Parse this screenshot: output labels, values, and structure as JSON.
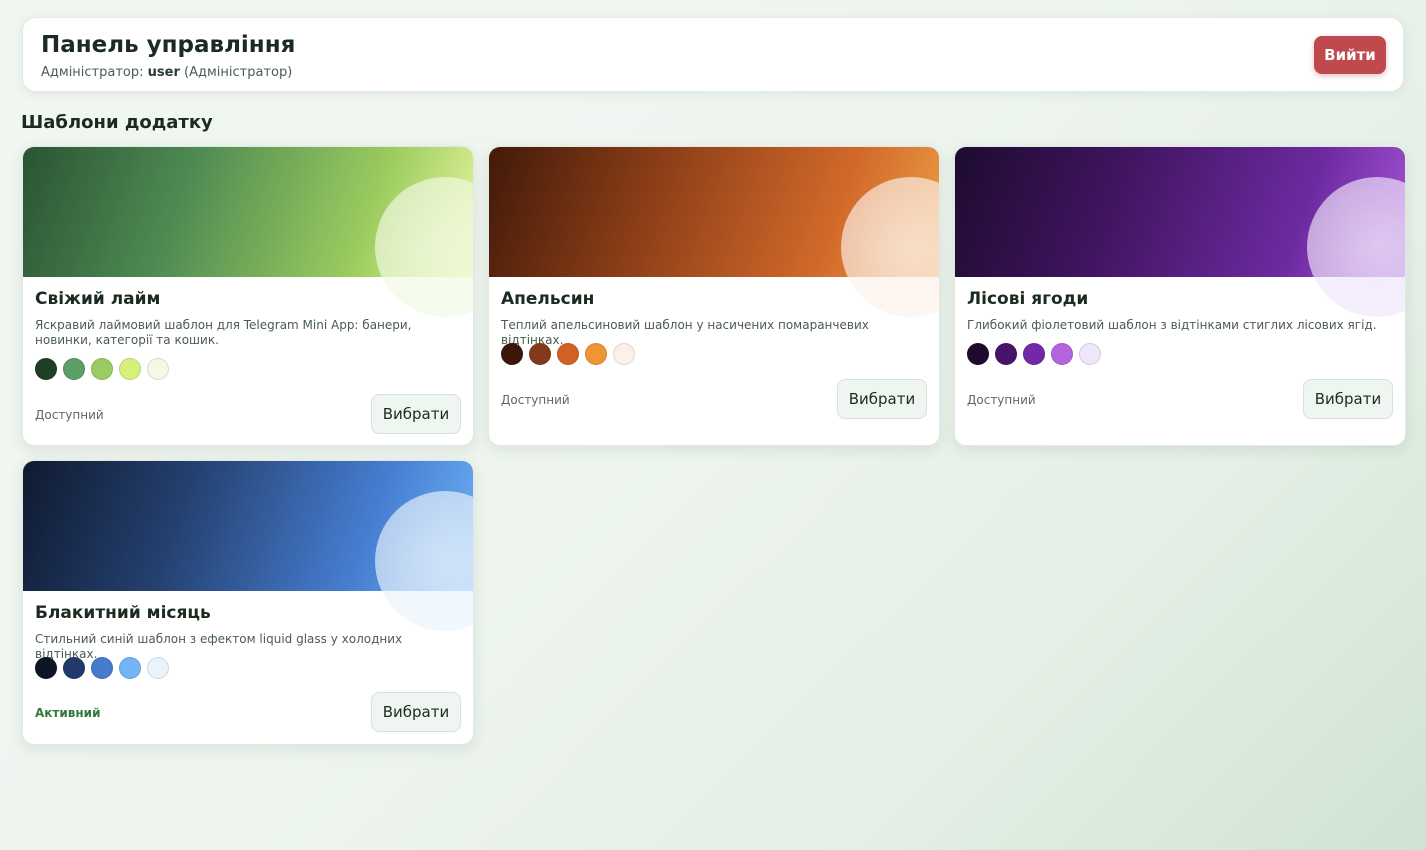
{
  "header": {
    "title": "Панель управління",
    "admin_prefix": "Адміністратор:",
    "username": "user",
    "role": "(Адміністратор)",
    "logout_label": "Вийти"
  },
  "section_title": "Шаблони додатку",
  "templates": [
    {
      "name": "Свіжий лайм",
      "description": "Яскравий лаймовий шаблон для Telegram Mini App: банери, новинки, категорії та кошик.",
      "palette": [
        "#1e3f26",
        "#5b9e66",
        "#9dcb63",
        "#d6f07c",
        "#f2fae4"
      ],
      "banner_gradient": [
        "#2a5434",
        "#4d8a52",
        "#9ccc5f",
        "#e8f7a0"
      ],
      "status": "Доступний",
      "active": false,
      "select_label": "Вибрати"
    },
    {
      "name": "Апельсин",
      "description": "Теплий апельсиновий шаблон у насичених помаранчевих відтінках.",
      "palette": [
        "#3a1708",
        "#86391a",
        "#cf6224",
        "#ef9534",
        "#fcf1ea"
      ],
      "banner_gradient": [
        "#421a09",
        "#8a3d17",
        "#d2692a",
        "#eda146"
      ],
      "status": "Доступний",
      "active": false,
      "select_label": "Вибрати"
    },
    {
      "name": "Лісові ягоди",
      "description": "Глибокий фіолетовий шаблон з відтінками стиглих лісових ягід.",
      "palette": [
        "#1c0b2c",
        "#461468",
        "#7427a8",
        "#b464dc",
        "#f0e6fb"
      ],
      "banner_gradient": [
        "#1d0b2f",
        "#40145f",
        "#6d2aa0",
        "#a757d6"
      ],
      "status": "Доступний",
      "active": false,
      "select_label": "Вибрати"
    },
    {
      "name": "Блакитний місяць",
      "description": "Стильний синій шаблон з ефектом liquid glass у холодних відтінках.",
      "palette": [
        "#0d1628",
        "#213a6b",
        "#4779cc",
        "#73b4f5",
        "#eaf3fc"
      ],
      "banner_gradient": [
        "#0f1a30",
        "#24406f",
        "#477ed2",
        "#6db3f6"
      ],
      "status": "Активний",
      "active": true,
      "select_label": "Вибрати"
    }
  ]
}
